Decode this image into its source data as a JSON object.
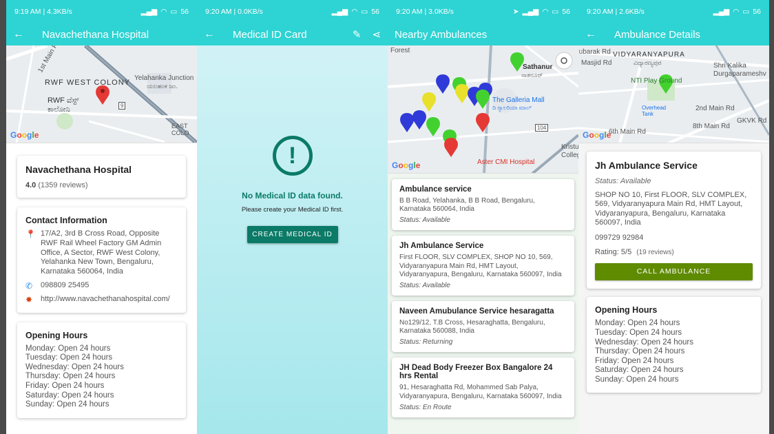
{
  "colors": {
    "accent": "#2ed3d3",
    "dark_green": "#0b7a67",
    "call_green": "#5f8b00",
    "pin_red": "#e53935",
    "pin_green": "#43d12f",
    "pin_blue": "#2f3ad8",
    "pin_yellow": "#e8e02a"
  },
  "screen1": {
    "status": {
      "time": "9:19 AM | 4.3KB/s",
      "battery": "56"
    },
    "appbar": {
      "title": "Navachethana Hospital",
      "back_icon": "arrow-left-icon"
    },
    "map": {
      "labels": [
        "1st Main Rd",
        "RWF WEST COLONY",
        "RWF ವೆಸ್ಟ್ ಕಾಲೋನಿ",
        "Yelahanka Junction",
        "ಯಲಹಂಕ ಜಂ.",
        "EAST COLO",
        "9"
      ]
    },
    "hospital": {
      "name": "Navachethana Hospital",
      "rating": "4.0",
      "reviews": "(1359 reviews)"
    },
    "contact": {
      "title": "Contact Information",
      "address": "17/A2, 3rd B Cross Road, Opposite RWF Rail Wheel Factory GM Admin Office, A Sector, RWF West Colony, Yelahanka New Town, Bengaluru, Karnataka 560064, India",
      "phone": "098809 25495",
      "website": "http://www.navachethanahospital.com/"
    },
    "hours": {
      "title": "Opening Hours",
      "lines": [
        "Monday: Open 24 hours",
        "Tuesday: Open 24 hours",
        "Wednesday: Open 24 hours",
        "Thursday: Open 24 hours",
        "Friday: Open 24 hours",
        "Saturday: Open 24 hours",
        "Sunday: Open 24 hours"
      ]
    }
  },
  "screen2": {
    "status": {
      "time": "9:20 AM | 0.0KB/s",
      "battery": "56"
    },
    "appbar": {
      "title": "Medical ID Card"
    },
    "message": {
      "icon": "!",
      "title": "No Medical ID data found.",
      "subtitle": "Please create your Medical ID first.",
      "button": "CREATE MEDICAL ID"
    }
  },
  "screen3": {
    "status": {
      "time": "9:20 AM | 3.0KB/s",
      "battery": "56"
    },
    "appbar": {
      "title": "Nearby Ambulances"
    },
    "map": {
      "labels": [
        "Forest",
        "Sathanur",
        "ಸಾತನೂರ್",
        "The Galleria Mall",
        "ದಿ ಗ್ಯಾಲರಿಯಾ ಮಾಲ್",
        "Aster CMI Hospital",
        "Kristu",
        "Colleg",
        "104"
      ]
    },
    "ambulances": [
      {
        "name": "Ambulance service",
        "address": "B B Road, Yelahanka, B B Road, Bengaluru, Karnataka 560064, India",
        "status": "Status: Available"
      },
      {
        "name": "Jh Ambulance Service",
        "address": "First FLOOR, SLV COMPLEX, SHOP NO 10, 569, Vidyaranyapura Main Rd, HMT Layout, Vidyaranyapura, Bengaluru, Karnataka 560097, India",
        "status": "Status: Available"
      },
      {
        "name": "Naveen Amubulance Service hesaragatta",
        "address": "No129/12, T.B Cross, Hesaraghatta, Bengaluru, Karnataka 560088, India",
        "status": "Status: Returning"
      },
      {
        "name": "JH Dead Body Freezer Box Bangalore 24 hrs Rental",
        "address": "91, Hesaraghatta Rd, Mohammed Sab Palya, Vidyaranyapura, Bengaluru, Karnataka 560097, India",
        "status": "Status: En Route"
      }
    ]
  },
  "screen4": {
    "status": {
      "time": "9:20 AM | 2.6KB/s",
      "battery": "56"
    },
    "appbar": {
      "title": "Ambulance Details"
    },
    "map": {
      "labels": [
        "Bubarak Rd",
        "VIDYARANYAPURA",
        "Masjid Rd",
        "ವಿದ್ಯಾರಣ್ಯಪುರ",
        "Shri Kalika",
        "Durgaparameshv",
        "NTI Play Ground",
        "Overhead Tank",
        "2nd Main Rd",
        "8th Main Rd",
        "GKVK Rd",
        "6th Main Rd"
      ]
    },
    "details": {
      "name": "Jh Ambulance Service",
      "status": "Status: Available",
      "address": "SHOP NO 10, First FLOOR, SLV COMPLEX, 569, Vidyaranyapura Main Rd, HMT Layout, Vidyaranyapura, Bengaluru, Karnataka 560097, India",
      "phone": "099729 92984",
      "rating": "Rating: 5/5",
      "reviews": "(19 reviews)",
      "button": "CALL AMBULANCE"
    },
    "hours": {
      "title": "Opening Hours",
      "lines": [
        "Monday: Open 24 hours",
        "Tuesday: Open 24 hours",
        "Wednesday: Open 24 hours",
        "Thursday: Open 24 hours",
        "Friday: Open 24 hours",
        "Saturday: Open 24 hours",
        "Sunday: Open 24 hours"
      ]
    }
  },
  "google_logo": "Google"
}
